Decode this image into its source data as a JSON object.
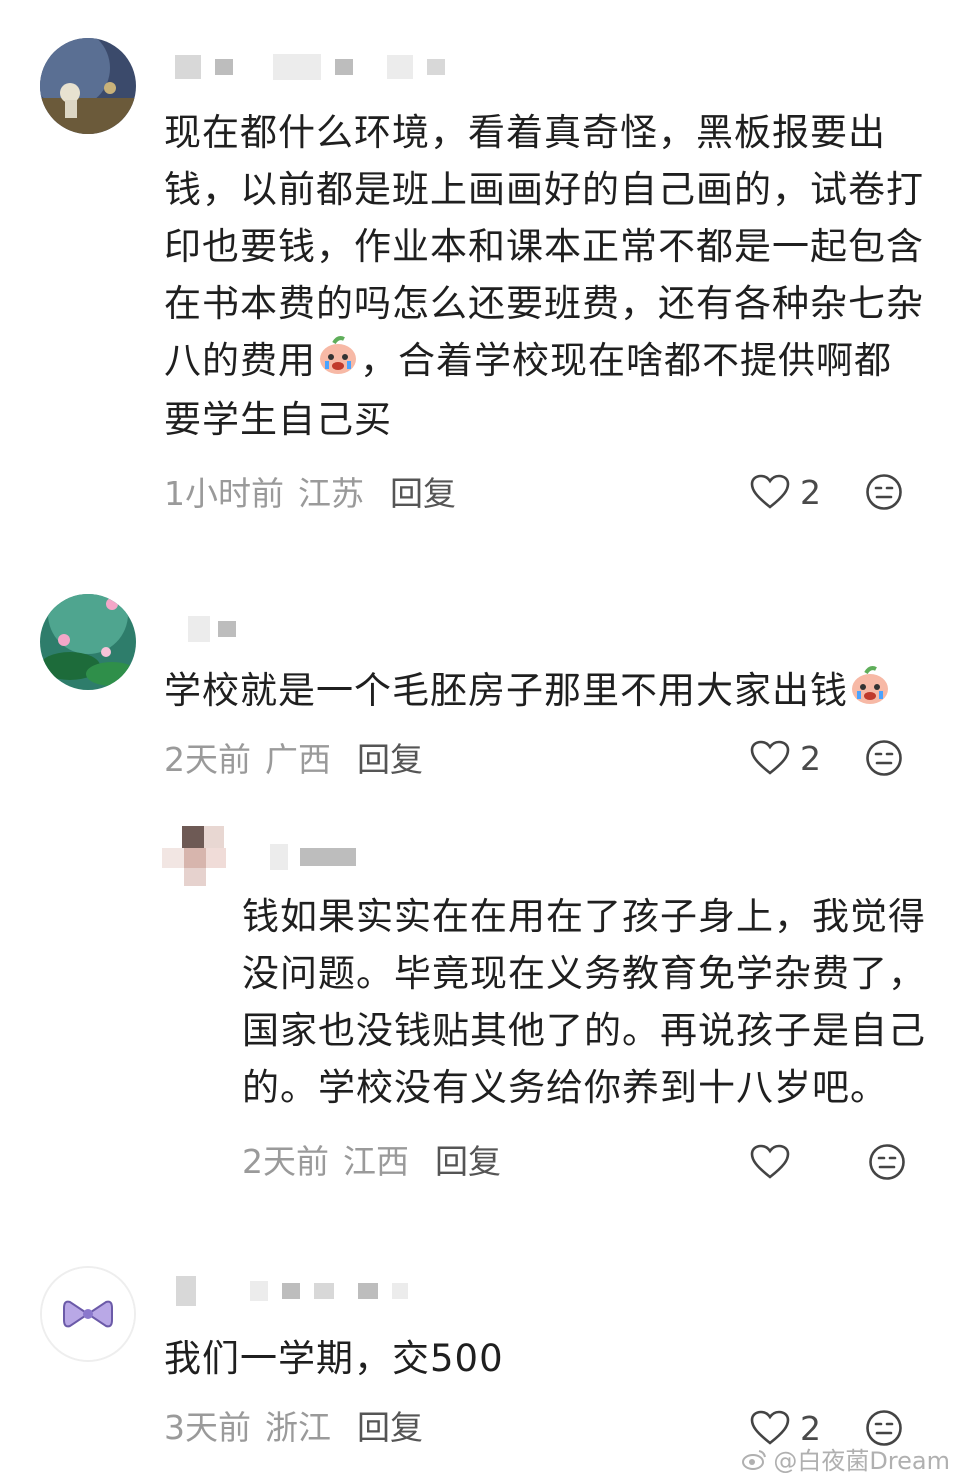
{
  "comments": [
    {
      "text": "现在都什么环境，看着真奇怪，黑板报要出钱，以前都是班上画画好的自己画的，试卷打印也要钱，作业本和课本正常不都是一起包含在书本费的吗怎么还要班费，还有各种杂七杂八的费用",
      "text_tail": "，合着学校现在啥都不提供啊都要学生自己买",
      "time": "1小时前",
      "region": "江苏",
      "reply_label": "回复",
      "likes": "2"
    },
    {
      "text": "学校就是一个毛胚房子那里不用大家出钱",
      "time": "2天前",
      "region": "广西",
      "reply_label": "回复",
      "likes": "2"
    },
    {
      "text": "钱如果实实在在用在了孩子身上，我觉得没问题。毕竟现在义务教育免学杂费了，国家也没钱贴其他了的。再说孩子是自己的。学校没有义务给你养到十八岁吧。",
      "time": "2天前",
      "region": "江西",
      "reply_label": "回复",
      "likes": ""
    },
    {
      "text": "我们一学期，交500",
      "time": "3天前",
      "region": "浙江",
      "reply_label": "回复",
      "likes": "2"
    }
  ],
  "watermark": "@白夜菌Dream",
  "icons": {
    "like": "heart-outline-icon",
    "dislike": "neutral-face-icon",
    "emoji": "crying-face-emoji"
  }
}
